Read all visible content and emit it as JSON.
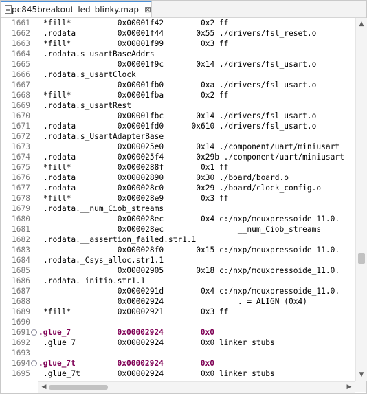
{
  "tab": {
    "title": "lpc845breakout_led_blinky.map",
    "close_glyph": "⊠",
    "icon": "text-file-icon"
  },
  "colors": {
    "section_keyword": "#7f0055",
    "line_number": "#787878",
    "tab_accent": "#4a90d9"
  },
  "lines": [
    {
      "num": "1661",
      "text": "*fill*          0x00001f42        0x2 ff"
    },
    {
      "num": "1662",
      "text": ".rodata         0x00001f44       0x55 ./drivers/fsl_reset.o"
    },
    {
      "num": "1663",
      "text": "*fill*          0x00001f99        0x3 ff"
    },
    {
      "num": "1664",
      "text": ".rodata.s_usartBaseAddrs"
    },
    {
      "num": "1665",
      "text": "                0x00001f9c       0x14 ./drivers/fsl_usart.o"
    },
    {
      "num": "1666",
      "text": ".rodata.s_usartClock"
    },
    {
      "num": "1667",
      "text": "                0x00001fb0        0xa ./drivers/fsl_usart.o"
    },
    {
      "num": "1668",
      "text": "*fill*          0x00001fba        0x2 ff"
    },
    {
      "num": "1669",
      "text": ".rodata.s_usartRest"
    },
    {
      "num": "1670",
      "text": "                0x00001fbc       0x14 ./drivers/fsl_usart.o"
    },
    {
      "num": "1671",
      "text": ".rodata         0x00001fd0      0x610 ./drivers/fsl_usart.o"
    },
    {
      "num": "1672",
      "text": ".rodata.s_UsartAdapterBase"
    },
    {
      "num": "1673",
      "text": "                0x000025e0       0x14 ./component/uart/miniusart"
    },
    {
      "num": "1674",
      "text": ".rodata         0x000025f4       0x29b ./component/uart/miniusart"
    },
    {
      "num": "1675",
      "text": "*fill*          0x0000288f        0x1 ff"
    },
    {
      "num": "1676",
      "text": ".rodata         0x00002890       0x30 ./board/board.o"
    },
    {
      "num": "1677",
      "text": ".rodata         0x000028c0       0x29 ./board/clock_config.o"
    },
    {
      "num": "1678",
      "text": "*fill*          0x000028e9        0x3 ff"
    },
    {
      "num": "1679",
      "text": ".rodata.__num_Ciob_streams"
    },
    {
      "num": "1680",
      "text": "                0x000028ec        0x4 c:/nxp/mcuxpressoide_11.0."
    },
    {
      "num": "1681",
      "text": "                0x000028ec                __num_Ciob_streams"
    },
    {
      "num": "1682",
      "text": ".rodata.__assertion_failed.str1.1"
    },
    {
      "num": "1683",
      "text": "                0x000028f0       0x15 c:/nxp/mcuxpressoide_11.0."
    },
    {
      "num": "1684",
      "text": ".rodata._Csys_alloc.str1.1"
    },
    {
      "num": "1685",
      "text": "                0x00002905       0x18 c:/nxp/mcuxpressoide_11.0."
    },
    {
      "num": "1686",
      "text": ".rodata._initio.str1.1"
    },
    {
      "num": "1687",
      "text": "                0x0000291d        0x4 c:/nxp/mcuxpressoide_11.0."
    },
    {
      "num": "1688",
      "text": "                0x00002924                . = ALIGN (0x4)"
    },
    {
      "num": "1689",
      "text": "*fill*          0x00002921        0x3 ff"
    },
    {
      "num": "1690",
      "text": ""
    },
    {
      "num": "1691",
      "text": ".glue_7          0x00002924        0x0",
      "section": true,
      "fold": "⊖"
    },
    {
      "num": "1692",
      "text": ".glue_7         0x00002924        0x0 linker stubs"
    },
    {
      "num": "1693",
      "text": ""
    },
    {
      "num": "1694",
      "text": ".glue_7t         0x00002924        0x0",
      "section": true,
      "fold": "⊖"
    },
    {
      "num": "1695",
      "text": ".glue_7t        0x00002924        0x0 linker stubs"
    }
  ],
  "scrollbars": {
    "up_glyph": "▲",
    "down_glyph": "▼",
    "left_glyph": "◀",
    "right_glyph": "▶"
  }
}
